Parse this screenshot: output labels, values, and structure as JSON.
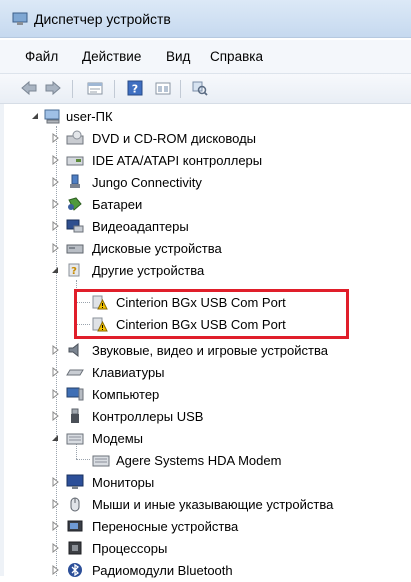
{
  "window": {
    "title": "Диспетчер устройств"
  },
  "menu": [
    "Файл",
    "Действие",
    "Вид",
    "Справка"
  ],
  "toolbar": [
    "back-icon",
    "forward-icon",
    "properties-icon",
    "help-icon",
    "details-icon",
    "scan-icon"
  ],
  "tree": {
    "root": "user-ПК",
    "items": [
      {
        "label": "DVD и CD-ROM дисководы",
        "icon": "dvd-drive-icon",
        "expanded": false
      },
      {
        "label": "IDE ATA/ATAPI контроллеры",
        "icon": "ide-controller-icon",
        "expanded": false
      },
      {
        "label": "Jungo Connectivity",
        "icon": "jungo-icon",
        "expanded": false
      },
      {
        "label": "Батареи",
        "icon": "battery-icon",
        "expanded": false
      },
      {
        "label": "Видеоадаптеры",
        "icon": "display-adapter-icon",
        "expanded": false
      },
      {
        "label": "Дисковые устройства",
        "icon": "disk-drive-icon",
        "expanded": false
      },
      {
        "label": "Другие устройства",
        "icon": "other-devices-icon",
        "expanded": true,
        "children": [
          "Cinterion BGx USB Com Port",
          "Cinterion BGx USB Com Port"
        ]
      },
      {
        "label": "Звуковые, видео и игровые устройства",
        "icon": "sound-icon",
        "expanded": false
      },
      {
        "label": "Клавиатуры",
        "icon": "keyboard-icon",
        "expanded": false
      },
      {
        "label": "Компьютер",
        "icon": "computer-icon",
        "expanded": false
      },
      {
        "label": "Контроллеры USB",
        "icon": "usb-icon",
        "expanded": false
      },
      {
        "label": "Модемы",
        "icon": "modem-icon",
        "expanded": true,
        "children": [
          "Agere Systems HDA Modem"
        ]
      },
      {
        "label": "Мониторы",
        "icon": "monitor-icon",
        "expanded": false
      },
      {
        "label": "Мыши и иные указывающие устройства",
        "icon": "mouse-icon",
        "expanded": false
      },
      {
        "label": "Переносные устройства",
        "icon": "portable-device-icon",
        "expanded": false
      },
      {
        "label": "Процессоры",
        "icon": "processor-icon",
        "expanded": false
      },
      {
        "label": "Радиомодули Bluetooth",
        "icon": "bluetooth-icon",
        "expanded": false
      }
    ]
  },
  "colors": {
    "highlight": "#e01e2a",
    "warning": "#f2c200"
  }
}
